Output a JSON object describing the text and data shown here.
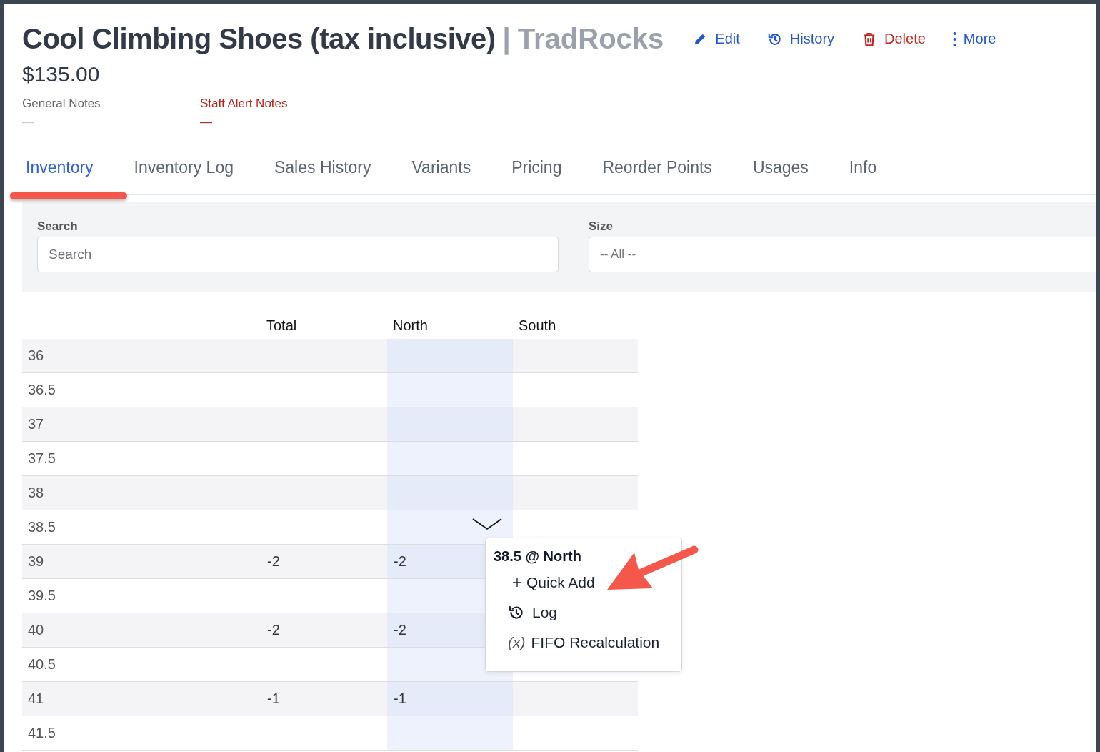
{
  "product": {
    "title": "Cool Climbing Shoes (tax inclusive)",
    "separator": "|",
    "store": "TradRocks",
    "price": "$135.00"
  },
  "actions": [
    {
      "label": "Edit",
      "kind": "edit"
    },
    {
      "label": "History",
      "kind": "history"
    },
    {
      "label": "Delete",
      "kind": "delete"
    },
    {
      "label": "More",
      "kind": "more"
    }
  ],
  "notes": [
    {
      "label": "General Notes",
      "value": "—",
      "alert": false
    },
    {
      "label": "Staff Alert Notes",
      "value": "—",
      "alert": true
    }
  ],
  "tabs": [
    {
      "label": "Inventory",
      "selected": true
    },
    {
      "label": "Inventory Log",
      "selected": false
    },
    {
      "label": "Sales History",
      "selected": false
    },
    {
      "label": "Variants",
      "selected": false
    },
    {
      "label": "Pricing",
      "selected": false
    },
    {
      "label": "Reorder Points",
      "selected": false
    },
    {
      "label": "Usages",
      "selected": false
    },
    {
      "label": "Info",
      "selected": false
    }
  ],
  "filters": {
    "search": {
      "label": "Search",
      "placeholder": "Search"
    },
    "size": {
      "label": "Size",
      "value": "-- All --"
    }
  },
  "table": {
    "columns": [
      {
        "label": "Total",
        "highlighted": false
      },
      {
        "label": "North",
        "highlighted": true
      },
      {
        "label": "South",
        "highlighted": false
      }
    ],
    "rows": [
      {
        "size": "36"
      },
      {
        "size": "36.5"
      },
      {
        "size": "37"
      },
      {
        "size": "37.5"
      },
      {
        "size": "38"
      },
      {
        "size": "38.5"
      },
      {
        "size": "39",
        "cells": [
          "-2",
          "-2"
        ]
      },
      {
        "size": "39.5"
      },
      {
        "size": "40",
        "cells": [
          "-2",
          "-2"
        ]
      },
      {
        "size": "40.5"
      },
      {
        "size": "41",
        "cells": [
          "-1",
          "-1"
        ]
      },
      {
        "size": "41.5"
      }
    ]
  },
  "popover": {
    "title": "38.5 @ North",
    "items": [
      {
        "label": "Quick Add",
        "kind": "add"
      },
      {
        "label": "Log",
        "kind": "log"
      },
      {
        "label": "FIFO Recalculation",
        "kind": "formula",
        "glyph": "(x)"
      }
    ]
  }
}
